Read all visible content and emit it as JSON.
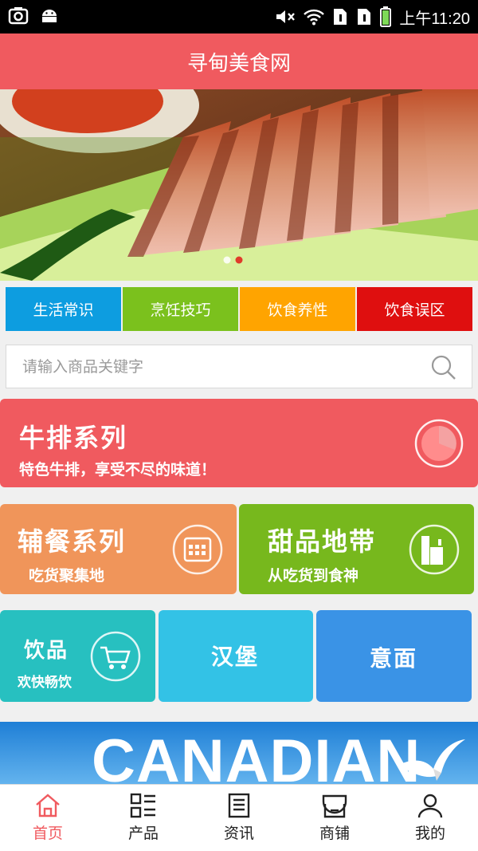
{
  "status": {
    "time": "上午11:20"
  },
  "title": "寻甸美食网",
  "categories": [
    {
      "label": "生活常识",
      "color": "#0d9de0"
    },
    {
      "label": "烹饪技巧",
      "color": "#7bc11d"
    },
    {
      "label": "饮食养性",
      "color": "#ffa400"
    },
    {
      "label": "饮食误区",
      "color": "#df0f0f"
    }
  ],
  "search": {
    "placeholder": "请输入商品关键字"
  },
  "cards": {
    "steak": {
      "title": "牛排系列",
      "subtitle": "特色牛排，享受不尽的味道！",
      "color": "#f05a5f"
    },
    "side": {
      "title": "辅餐系列",
      "subtitle": "吃货聚集地",
      "color": "#f0955a"
    },
    "dessert": {
      "title": "甜品地带",
      "subtitle": "从吃货到食神",
      "color": "#77b81d"
    },
    "drinks": {
      "title": "饮品",
      "subtitle": "欢快畅饮",
      "color": "#27c0c0"
    },
    "burger": {
      "title": "汉堡",
      "color": "#33c2e6"
    },
    "pasta": {
      "title": "意面",
      "color": "#3a93e6"
    }
  },
  "promo": {
    "text": "CANADIAN"
  },
  "tabs": [
    {
      "label": "首页",
      "icon": "home-icon",
      "active": true
    },
    {
      "label": "产品",
      "icon": "grid-list-icon"
    },
    {
      "label": "资讯",
      "icon": "news-icon"
    },
    {
      "label": "商铺",
      "icon": "shop-icon"
    },
    {
      "label": "我的",
      "icon": "user-icon"
    }
  ],
  "colors": {
    "accent": "#f05a5f"
  }
}
